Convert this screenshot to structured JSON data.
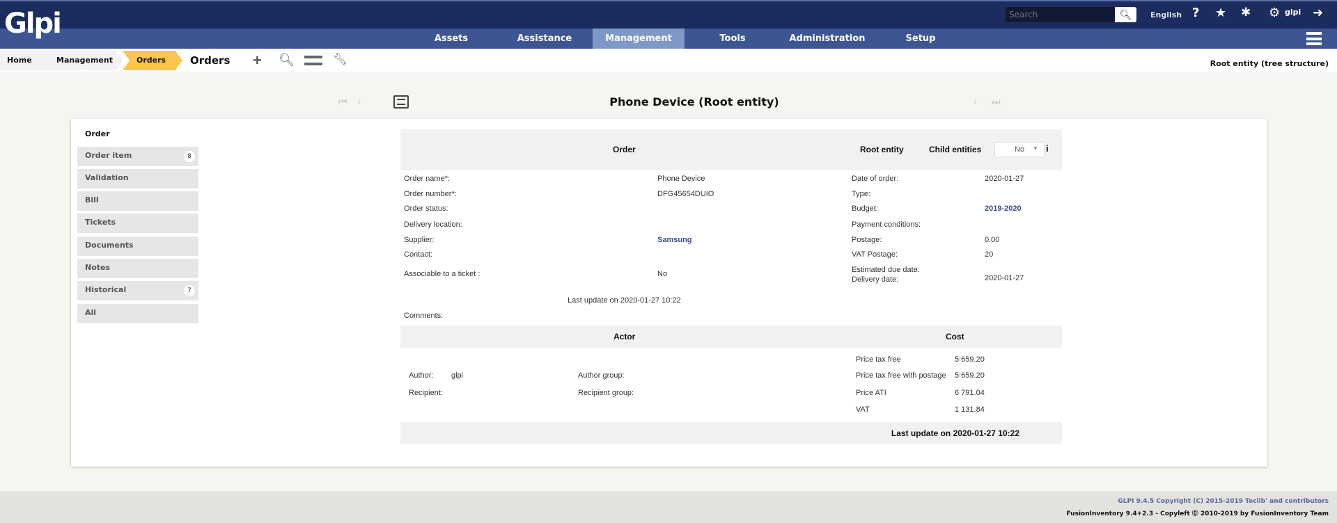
{
  "header": {
    "logo": "Glpi",
    "search_placeholder": "Search",
    "language": "English",
    "user": "glpi"
  },
  "nav": [
    {
      "label": "Assets"
    },
    {
      "label": "Assistance"
    },
    {
      "label": "Management",
      "active": true
    },
    {
      "label": "Tools"
    },
    {
      "label": "Administration"
    },
    {
      "label": "Setup"
    }
  ],
  "breadcrumb": {
    "items": [
      "Home",
      "Management",
      "Orders"
    ],
    "title": "Orders",
    "entity": "Root entity (tree structure)"
  },
  "page": {
    "title": "Phone Device (Root entity)"
  },
  "tabs": [
    {
      "label": "Order"
    },
    {
      "label": "Order item",
      "badge": "8"
    },
    {
      "label": "Validation"
    },
    {
      "label": "Bill"
    },
    {
      "label": "Tickets"
    },
    {
      "label": "Documents"
    },
    {
      "label": "Notes"
    },
    {
      "label": "Historical",
      "badge": "7"
    },
    {
      "label": "All"
    }
  ],
  "form": {
    "header": {
      "title": "Order",
      "entity": "Root entity",
      "child_label": "Child entities",
      "child_value": "No"
    },
    "left": [
      {
        "label": "Order name*:",
        "value": "Phone Device"
      },
      {
        "label": "Order number*:",
        "value": "DFG45654DUIO"
      },
      {
        "label": "Order status:",
        "value": ""
      },
      {
        "label": "Delivery location:",
        "value": ""
      },
      {
        "label": "Supplier:",
        "value": "Samsung"
      },
      {
        "label": "Contact:",
        "value": ""
      },
      {
        "label": "Associable to a ticket :",
        "value": "No"
      }
    ],
    "right": [
      {
        "label": "Date of order:",
        "value": "2020-01-27"
      },
      {
        "label": "Type:",
        "value": ""
      },
      {
        "label": "Budget:",
        "value": "2019-2020"
      },
      {
        "label": "Payment conditions:",
        "value": ""
      },
      {
        "label": "Postage:",
        "value": "0.00"
      },
      {
        "label": "VAT Postage:",
        "value": "20"
      },
      {
        "label": "Estimated due date:",
        "value": ""
      },
      {
        "label": "Delivery date:",
        "value": "2020-01-27"
      }
    ],
    "last_update": "Last update on 2020-01-27 10:22",
    "comments_label": "Comments:",
    "actor_header": "Actor",
    "cost_header": "Cost",
    "author_label": "Author:",
    "author_value": "glpi",
    "author_group_label": "Author group:",
    "recipient_label": "Recipient:",
    "recipient_group_label": "Recipient group:",
    "costs": [
      {
        "label": "Price tax free",
        "value": "5 659.20"
      },
      {
        "label": "Price tax free with postage",
        "value": "5 659.20"
      },
      {
        "label": "Price ATI",
        "value": "6 791.04"
      },
      {
        "label": "VAT",
        "value": "1 131.84"
      }
    ],
    "footer_update": "Last update on 2020-01-27 10:22"
  },
  "footer": {
    "line1": "GLPI 9.4.5 Copyright (C) 2015-2019 Teclib' and contributors",
    "line2": "FusionInventory 9.4+2.3 - Copyleft ⓪ 2010-2019 by FusionInventory Team"
  }
}
